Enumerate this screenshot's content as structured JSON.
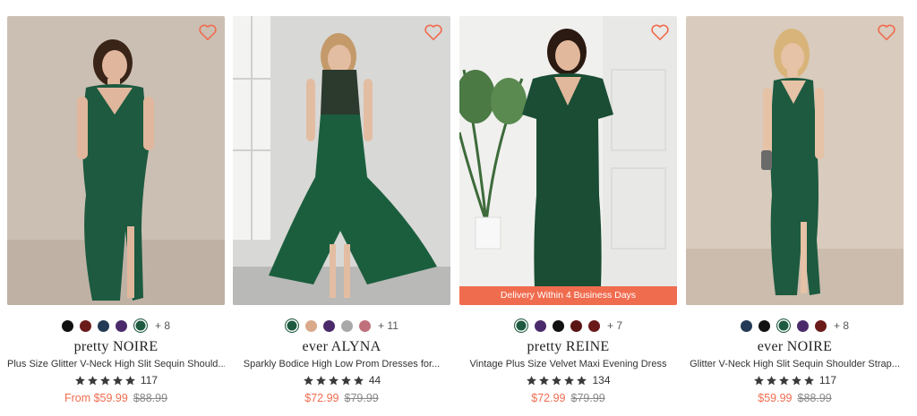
{
  "colors": {
    "accent": "#f06c4f",
    "star": "#3a3a3a",
    "dress": "#1d5a40"
  },
  "icons": {
    "wishlist": "heart-outline-icon",
    "star": "star-icon"
  },
  "products": [
    {
      "brand": "pretty NOIRE",
      "title": "Plus Size Glitter V-Neck High Slit Sequin Should...",
      "reviews": "117",
      "price": "From $59.99",
      "old_price": "$88.99",
      "swatches": [
        "#111111",
        "#6b1a1a",
        "#223a55",
        "#4b2a6b",
        "#1d5a40"
      ],
      "selected": 4,
      "more": "+ 8",
      "badge": ""
    },
    {
      "brand": "ever ALYNA",
      "title": "Sparkly Bodice High Low Prom Dresses for...",
      "reviews": "44",
      "price": "$72.99",
      "old_price": "$79.99",
      "swatches": [
        "#1d5a40",
        "#d9a98a",
        "#4b2a6b",
        "#a8a8a8",
        "#c0707a"
      ],
      "selected": 0,
      "more": "+ 11",
      "badge": ""
    },
    {
      "brand": "pretty REINE",
      "title": "Vintage Plus Size Velvet Maxi Evening Dress",
      "reviews": "134",
      "price": "$72.99",
      "old_price": "$79.99",
      "swatches": [
        "#1d5a40",
        "#4b2a6b",
        "#111111",
        "#5a1515",
        "#6b1a1a"
      ],
      "selected": 0,
      "more": "+ 7",
      "badge": "Delivery Within 4 Business Days"
    },
    {
      "brand": "ever NOIRE",
      "title": "Glitter V-Neck High Slit Sequin Shoulder Strap...",
      "reviews": "117",
      "price": "$59.99",
      "old_price": "$88.99",
      "swatches": [
        "#223a55",
        "#111111",
        "#1d5a40",
        "#4b2a6b",
        "#6b1a1a"
      ],
      "selected": 2,
      "more": "+ 8",
      "badge": ""
    }
  ]
}
